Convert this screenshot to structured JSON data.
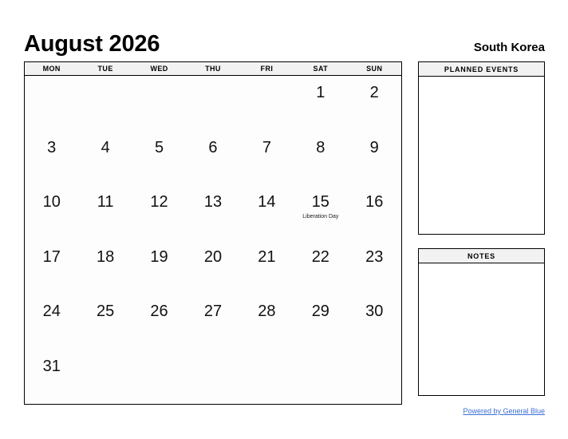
{
  "header": {
    "month_title": "August 2026",
    "country": "South Korea"
  },
  "calendar": {
    "weekdays": [
      "MON",
      "TUE",
      "WED",
      "THU",
      "FRI",
      "SAT",
      "SUN"
    ],
    "weeks": [
      [
        {
          "day": "",
          "event": ""
        },
        {
          "day": "",
          "event": ""
        },
        {
          "day": "",
          "event": ""
        },
        {
          "day": "",
          "event": ""
        },
        {
          "day": "",
          "event": ""
        },
        {
          "day": "1",
          "event": ""
        },
        {
          "day": "2",
          "event": ""
        }
      ],
      [
        {
          "day": "3",
          "event": ""
        },
        {
          "day": "4",
          "event": ""
        },
        {
          "day": "5",
          "event": ""
        },
        {
          "day": "6",
          "event": ""
        },
        {
          "day": "7",
          "event": ""
        },
        {
          "day": "8",
          "event": ""
        },
        {
          "day": "9",
          "event": ""
        }
      ],
      [
        {
          "day": "10",
          "event": ""
        },
        {
          "day": "11",
          "event": ""
        },
        {
          "day": "12",
          "event": ""
        },
        {
          "day": "13",
          "event": ""
        },
        {
          "day": "14",
          "event": ""
        },
        {
          "day": "15",
          "event": "Liberation Day"
        },
        {
          "day": "16",
          "event": ""
        }
      ],
      [
        {
          "day": "17",
          "event": ""
        },
        {
          "day": "18",
          "event": ""
        },
        {
          "day": "19",
          "event": ""
        },
        {
          "day": "20",
          "event": ""
        },
        {
          "day": "21",
          "event": ""
        },
        {
          "day": "22",
          "event": ""
        },
        {
          "day": "23",
          "event": ""
        }
      ],
      [
        {
          "day": "24",
          "event": ""
        },
        {
          "day": "25",
          "event": ""
        },
        {
          "day": "26",
          "event": ""
        },
        {
          "day": "27",
          "event": ""
        },
        {
          "day": "28",
          "event": ""
        },
        {
          "day": "29",
          "event": ""
        },
        {
          "day": "30",
          "event": ""
        }
      ],
      [
        {
          "day": "31",
          "event": ""
        },
        {
          "day": "",
          "event": ""
        },
        {
          "day": "",
          "event": ""
        },
        {
          "day": "",
          "event": ""
        },
        {
          "day": "",
          "event": ""
        },
        {
          "day": "",
          "event": ""
        },
        {
          "day": "",
          "event": ""
        }
      ]
    ]
  },
  "panels": {
    "planned_events": {
      "title": "PLANNED EVENTS",
      "content": ""
    },
    "notes": {
      "title": "NOTES",
      "content": ""
    }
  },
  "footer": {
    "link_text": "Powered by General Blue"
  },
  "colors": {
    "link": "#3b6fd4",
    "border": "#000000",
    "header_fill": "#f2f2f2",
    "page_bg": "#ffffff"
  }
}
